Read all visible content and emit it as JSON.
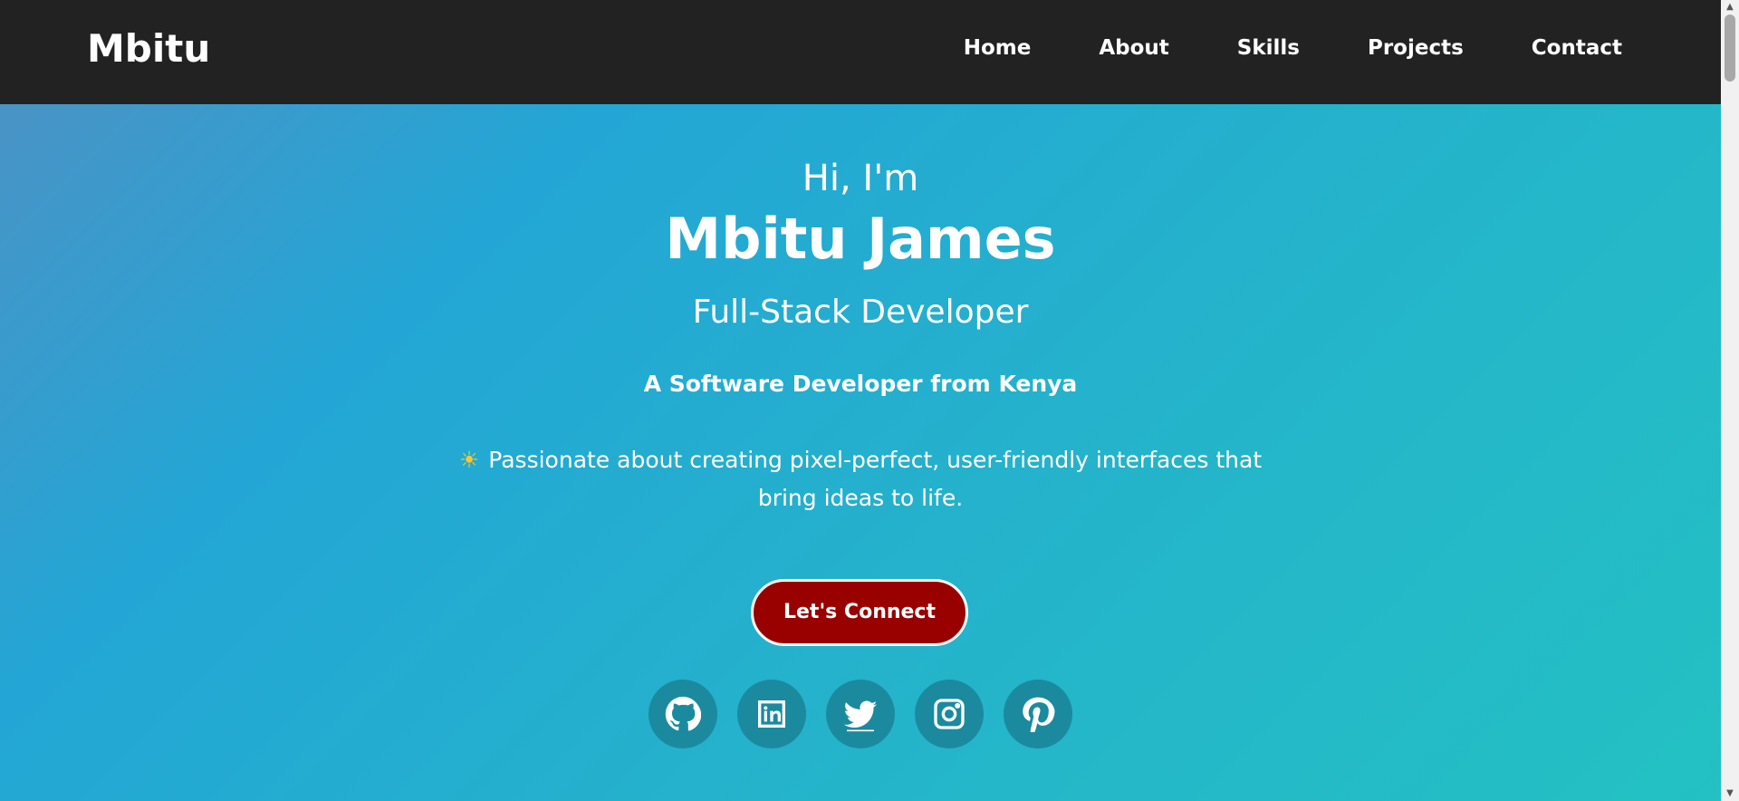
{
  "header": {
    "brand": "Mbitu",
    "nav": [
      "Home",
      "About",
      "Skills",
      "Projects",
      "Contact"
    ]
  },
  "hero": {
    "greeting": "Hi, I'm",
    "name": "Mbitu James",
    "role": "Full-Stack Developer",
    "tagline": "A Software Developer from Kenya",
    "bio_icon": "☀",
    "bio": "Passionate about creating pixel-perfect, user-friendly interfaces that bring ideas to life.",
    "cta": "Let's Connect"
  },
  "socials": [
    "github-icon",
    "linkedin-icon",
    "twitter-icon",
    "instagram-icon",
    "pinterest-icon"
  ],
  "colors": {
    "navbar_bg": "#222222",
    "cta_bg": "#990000",
    "social_bg": "#1b8a9f",
    "gradient_start": "#4a93c6",
    "gradient_end": "#23c1c3"
  }
}
